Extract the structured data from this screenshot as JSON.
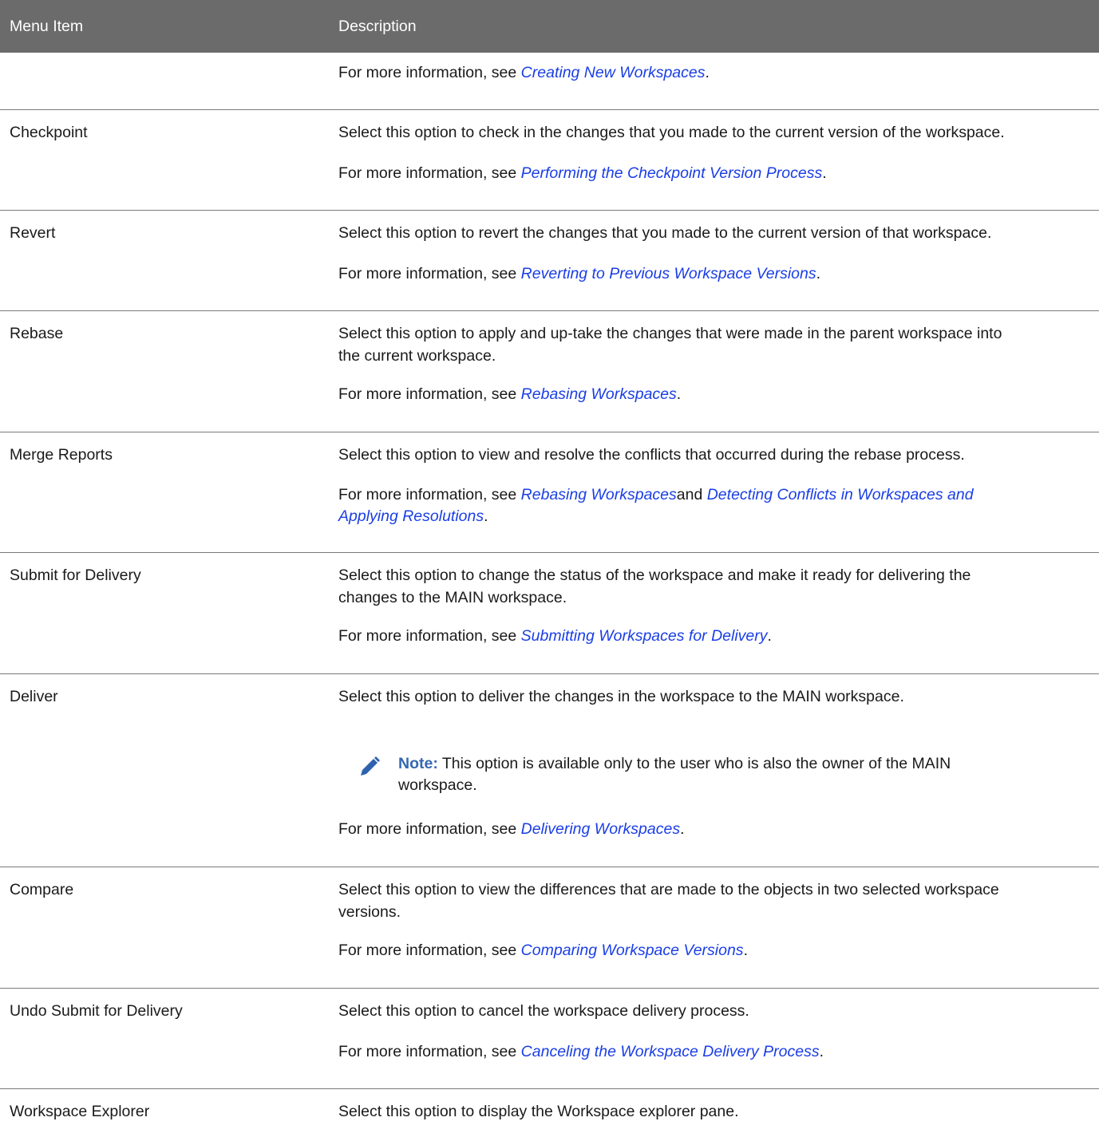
{
  "header": {
    "col1": "Menu Item",
    "col2": "Description"
  },
  "rows": [
    {
      "item": "",
      "desc": "",
      "more_prefix": "For more information, see ",
      "links": [
        "Creating New Workspaces"
      ],
      "more_suffix": "."
    },
    {
      "item": "Checkpoint",
      "desc": "Select this option to check in the changes that you made to the current version of the workspace.",
      "more_prefix": "For more information, see ",
      "links": [
        "Performing the Checkpoint Version Process"
      ],
      "more_suffix": "."
    },
    {
      "item": "Revert",
      "desc": "Select this option to revert the changes that you made to the current version of that workspace.",
      "more_prefix": "For more information, see ",
      "links": [
        "Reverting to Previous Workspace Versions"
      ],
      "more_suffix": "."
    },
    {
      "item": "Rebase",
      "desc_line1": "Select this option to apply and up-take the changes that were made in the parent workspace into",
      "desc_line2": "the current workspace.",
      "more_prefix": "For more information, see ",
      "links": [
        "Rebasing Workspaces"
      ],
      "more_suffix": "."
    },
    {
      "item": "Merge Reports",
      "desc": "Select this option to view and resolve the conflicts that occurred during the rebase process.",
      "more_prefix": "For more information, see ",
      "link1": "Rebasing Workspaces",
      "connector": "and ",
      "link2_line1": "Detecting Conflicts in Workspaces and",
      "link2_line2": "Applying Resolutions",
      "more_suffix": "."
    },
    {
      "item": "Submit for Delivery",
      "desc_line1": "Select this option to change the status of the workspace and make it ready for delivering the",
      "desc_line2": "changes to the MAIN workspace.",
      "more_prefix": "For more information, see ",
      "links": [
        "Submitting Workspaces for Delivery"
      ],
      "more_suffix": "."
    },
    {
      "item": "Deliver",
      "desc": "Select this option to deliver the changes in the workspace to the MAIN workspace.",
      "note_label": "Note:",
      "note_line1": " This option is available only to the user who is also the owner of the MAIN",
      "note_line2": "workspace.",
      "more_prefix": "For more information, see ",
      "links": [
        "Delivering Workspaces"
      ],
      "more_suffix": "."
    },
    {
      "item": "Compare",
      "desc_line1": "Select this option to view the differences that are made to the objects in two selected workspace",
      "desc_line2": "versions.",
      "more_prefix": "For more information, see ",
      "links": [
        "Comparing Workspace Versions"
      ],
      "more_suffix": "."
    },
    {
      "item": "Undo Submit for Delivery",
      "desc": "Select this option to cancel the workspace delivery process.",
      "more_prefix": "For more information, see ",
      "links": [
        "Canceling the Workspace Delivery Process"
      ],
      "more_suffix": "."
    },
    {
      "item": "Workspace Explorer",
      "desc": "Select this option to display the Workspace explorer pane."
    }
  ],
  "colors": {
    "header_bg": "#6b6b6b",
    "link": "#1a3ee6",
    "note_label": "#3568b0",
    "note_icon": "#2f62ad"
  },
  "icons": {
    "note": "pencil-icon"
  }
}
